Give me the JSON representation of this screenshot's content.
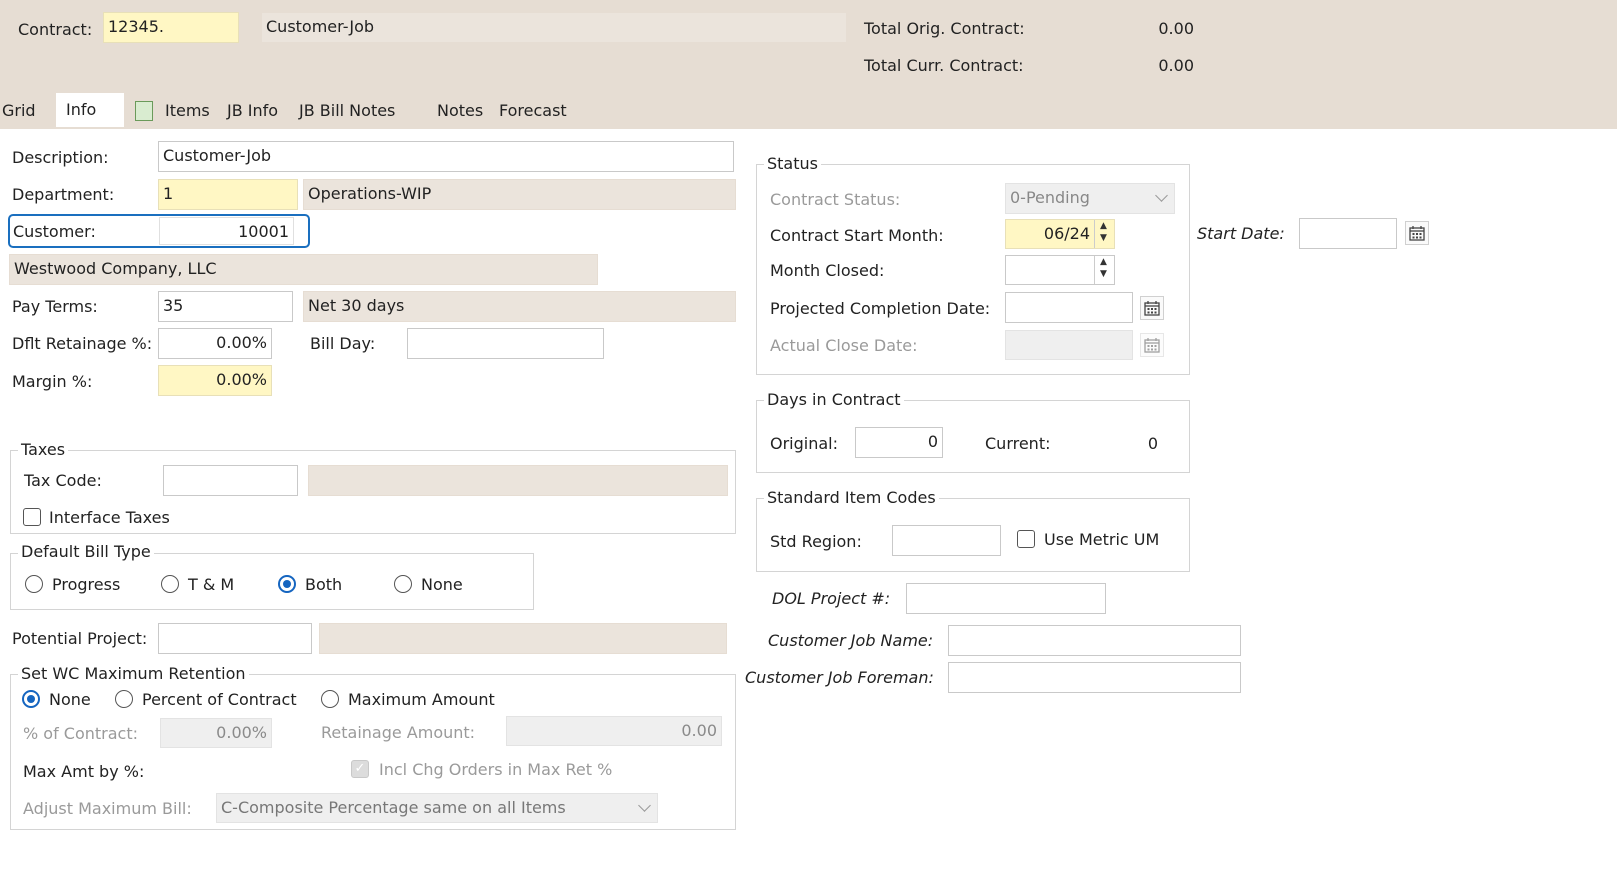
{
  "header": {
    "contract_label": "Contract:",
    "contract_value": "12345.",
    "contract_desc": "Customer-Job",
    "total_orig_label": "Total Orig. Contract:",
    "total_orig_value": "0.00",
    "total_curr_label": "Total Curr. Contract:",
    "total_curr_value": "0.00"
  },
  "tabs": [
    "Grid",
    "Info",
    "Items",
    "JB Info",
    "JB Bill Notes",
    "Notes",
    "Forecast"
  ],
  "active_tab": "Info",
  "info": {
    "description_label": "Description:",
    "description_value": "Customer-Job",
    "department_label": "Department:",
    "department_value": "1",
    "department_desc": "Operations-WIP",
    "customer_label": "Customer:",
    "customer_value": "10001",
    "customer_name": "Westwood Company, LLC",
    "pay_terms_label": "Pay Terms:",
    "pay_terms_value": "35",
    "pay_terms_desc": "Net 30 days",
    "retainage_label": "Dflt Retainage %:",
    "retainage_value": "0.00%",
    "bill_day_label": "Bill Day:",
    "margin_label": "Margin %:",
    "margin_value": "0.00%"
  },
  "taxes": {
    "title": "Taxes",
    "tax_code_label": "Tax Code:",
    "interface_taxes_label": "Interface Taxes"
  },
  "bill_type": {
    "title": "Default Bill Type",
    "options": [
      "Progress",
      "T & M",
      "Both",
      "None"
    ],
    "selected": "Both"
  },
  "potential_project_label": "Potential Project:",
  "wc_retention": {
    "title": "Set WC Maximum Retention",
    "options": [
      "None",
      "Percent of Contract",
      "Maximum Amount"
    ],
    "selected": "None",
    "pct_contract_label": "% of Contract:",
    "pct_contract_value": "0.00%",
    "retainage_amount_label": "Retainage Amount:",
    "retainage_amount_value": "0.00",
    "max_amt_label": "Max Amt by %:",
    "incl_chg_label": "Incl Chg Orders in Max Ret %",
    "adjust_max_label": "Adjust Maximum Bill:",
    "adjust_max_value": "C-Composite Percentage same on all Items"
  },
  "status": {
    "title": "Status",
    "contract_status_label": "Contract Status:",
    "contract_status_value": "0-Pending",
    "start_month_label": "Contract Start Month:",
    "start_month_value": "06/24",
    "month_closed_label": "Month Closed:",
    "projected_completion_label": "Projected Completion Date:",
    "actual_close_label": "Actual Close Date:",
    "start_date_label": "Start Date:"
  },
  "days": {
    "title": "Days in Contract",
    "original_label": "Original:",
    "original_value": "0",
    "current_label": "Current:",
    "current_value": "0"
  },
  "std_codes": {
    "title": "Standard Item Codes",
    "region_label": "Std Region:",
    "metric_label": "Use Metric UM"
  },
  "extra": {
    "dol_label": "DOL Project #:",
    "job_name_label": "Customer Job Name:",
    "job_foreman_label": "Customer Job Foreman:"
  },
  "colors": {
    "header_bg": "#e6ddd3",
    "required_field": "#fff7c4",
    "focus_outline": "#1a6fbf",
    "radio_selected": "#1565c0"
  }
}
